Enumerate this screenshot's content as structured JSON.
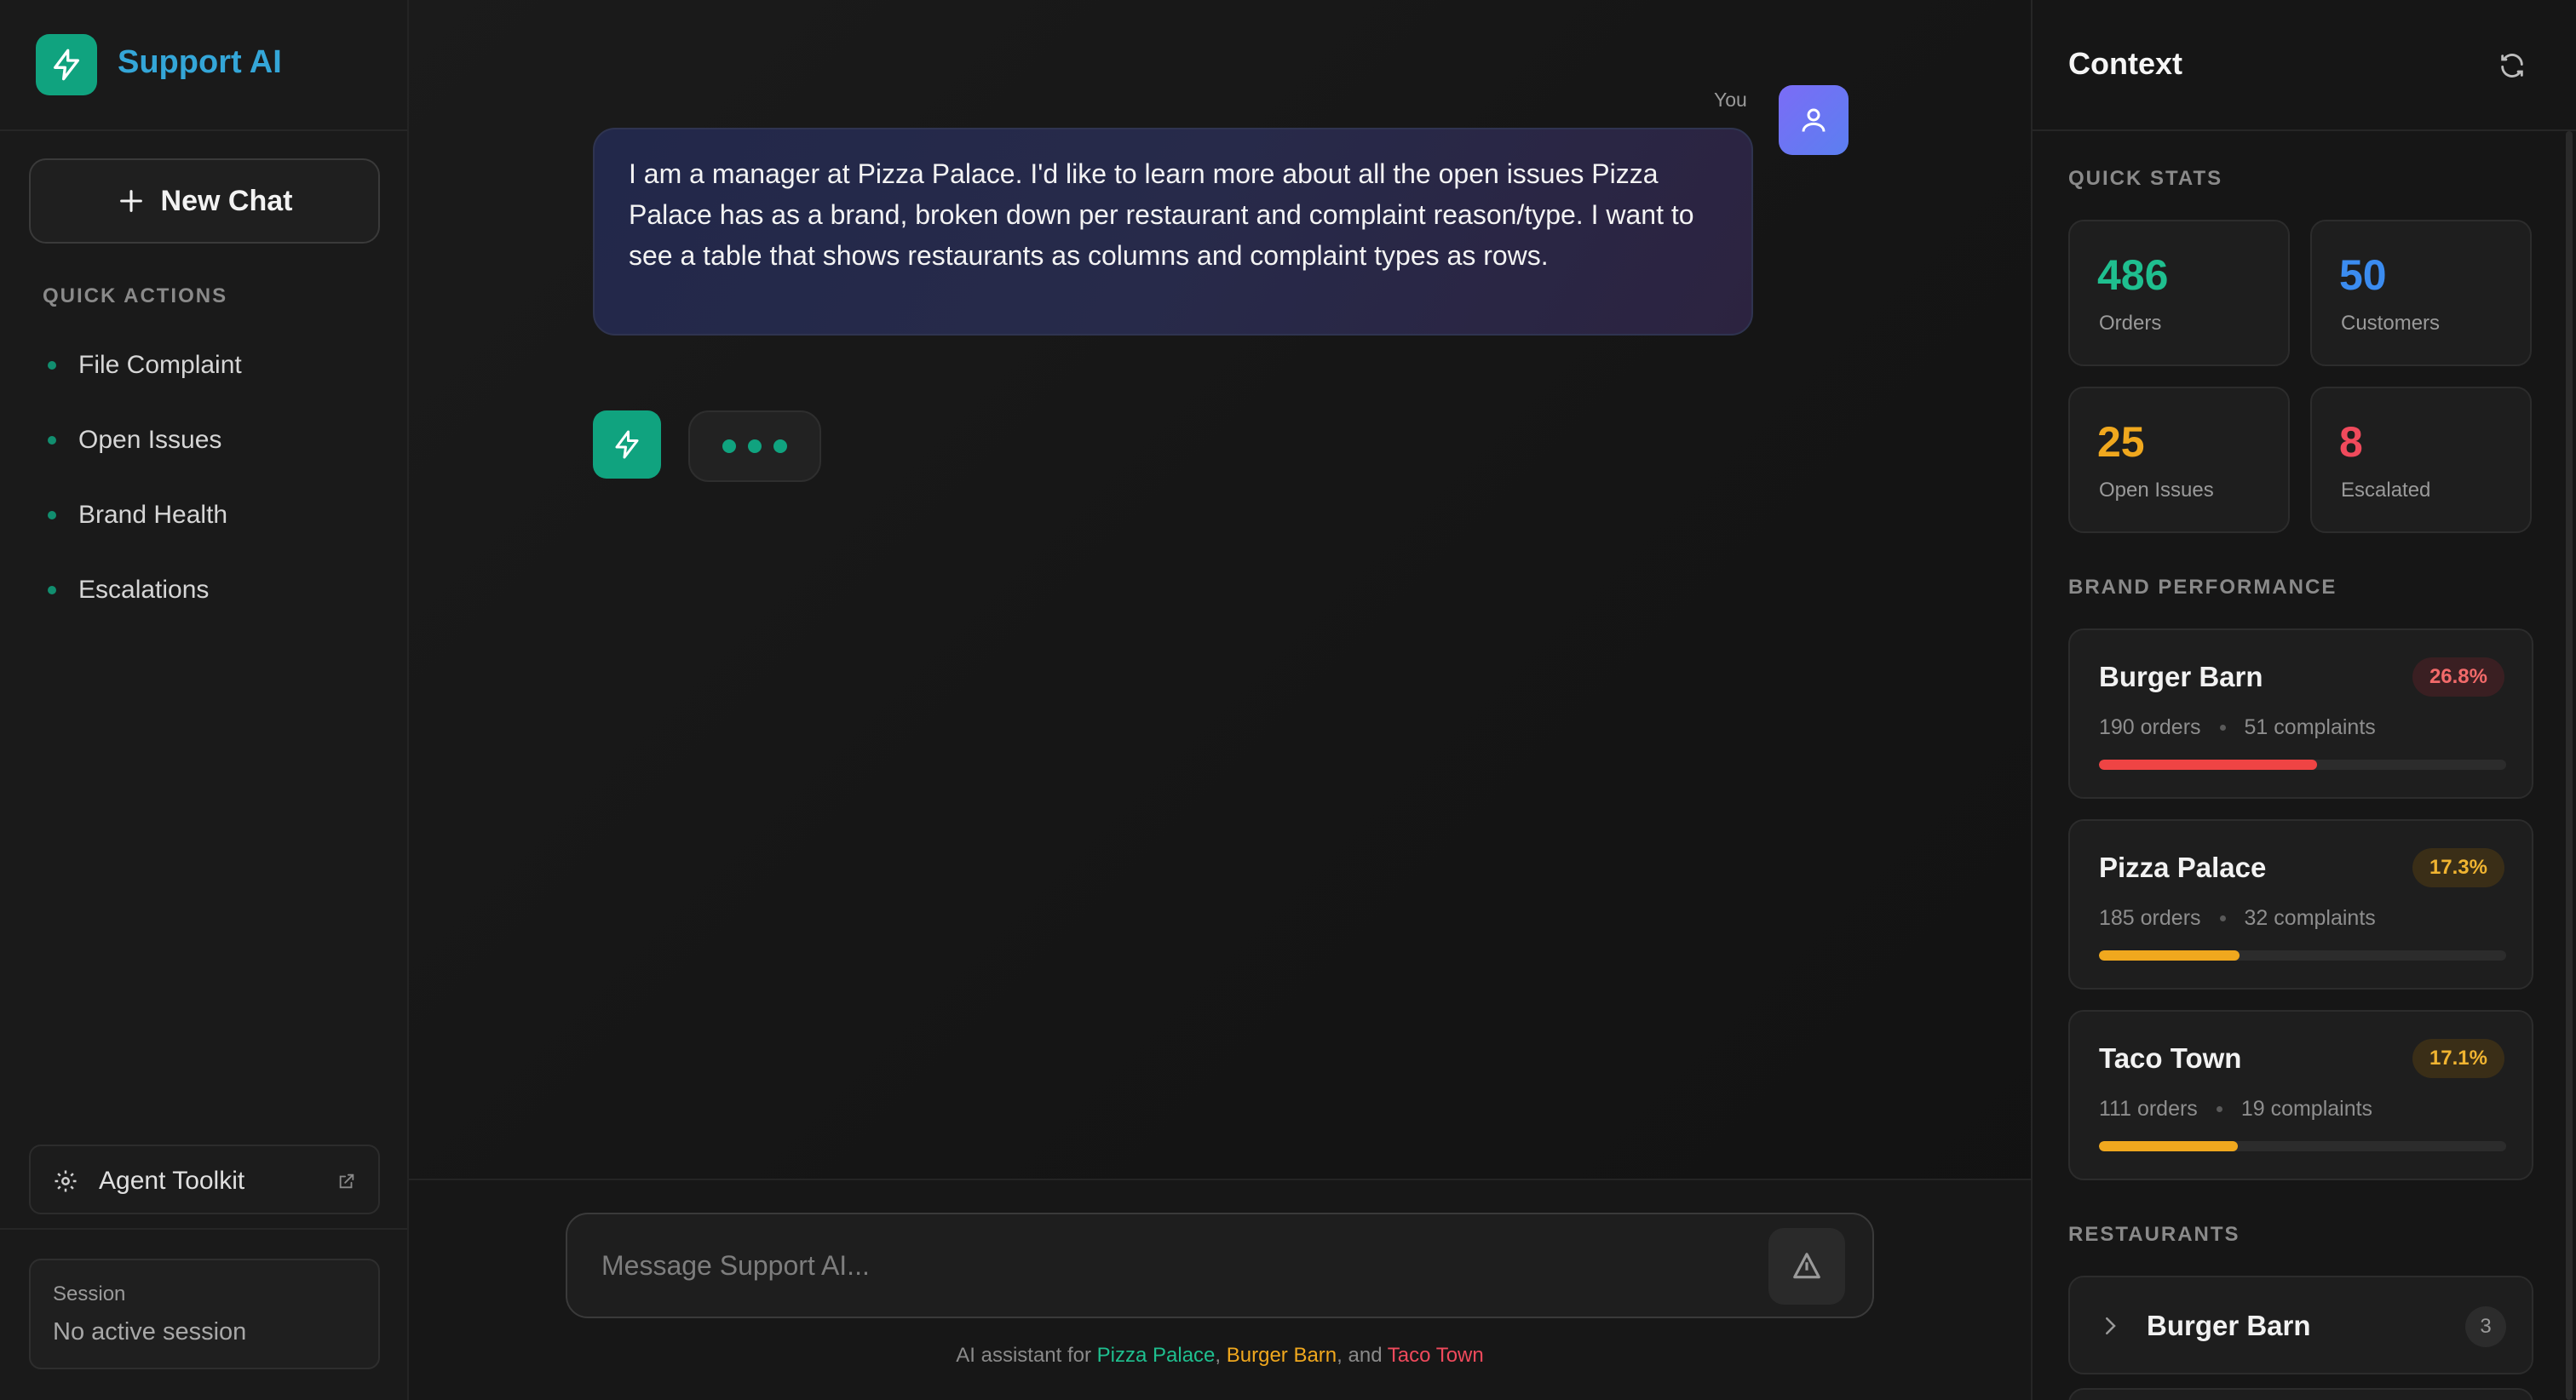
{
  "sidebar": {
    "app_title": "Support AI",
    "new_chat_label": "New Chat",
    "quick_actions_heading": "QUICK ACTIONS",
    "quick_actions": [
      {
        "label": "File Complaint"
      },
      {
        "label": "Open Issues"
      },
      {
        "label": "Brand Health"
      },
      {
        "label": "Escalations"
      }
    ],
    "toolkit_label": "Agent Toolkit",
    "session": {
      "label": "Session",
      "value": "No active session"
    }
  },
  "chat": {
    "user_label": "You",
    "user_message": "I am a manager at Pizza Palace. I'd like to learn more about all the open issues Pizza Palace has as a brand, broken down per restaurant and complaint reason/type. I want to see a table that shows restaurants as columns and complaint types as rows.",
    "input_placeholder": "Message Support AI...",
    "footer": {
      "prefix": "AI assistant for ",
      "brand1": "Pizza Palace",
      "sep1": ", ",
      "brand2": "Burger Barn",
      "sep2": ", and ",
      "brand3": "Taco Town"
    }
  },
  "context": {
    "title": "Context",
    "quick_stats_heading": "QUICK STATS",
    "stats": [
      {
        "value": "486",
        "label": "Orders",
        "color": "#1fbf8f"
      },
      {
        "value": "50",
        "label": "Customers",
        "color": "#3b8cf0"
      },
      {
        "value": "25",
        "label": "Open Issues",
        "color": "#f0a81e"
      },
      {
        "value": "8",
        "label": "Escalated",
        "color": "#f04a5c"
      }
    ],
    "brand_performance_heading": "BRAND PERFORMANCE",
    "brands": [
      {
        "name": "Burger Barn",
        "rate": "26.8%",
        "orders": "190 orders",
        "complaints": "51 complaints",
        "progress": 0.536,
        "color": "#ef4444"
      },
      {
        "name": "Pizza Palace",
        "rate": "17.3%",
        "orders": "185 orders",
        "complaints": "32 complaints",
        "progress": 0.346,
        "color": "#f0a81e"
      },
      {
        "name": "Taco Town",
        "rate": "17.1%",
        "orders": "111 orders",
        "complaints": "19 complaints",
        "progress": 0.342,
        "color": "#f0a81e"
      }
    ],
    "restaurants_heading": "RESTAURANTS",
    "restaurants": [
      {
        "name": "Burger Barn",
        "count": "3"
      }
    ]
  }
}
